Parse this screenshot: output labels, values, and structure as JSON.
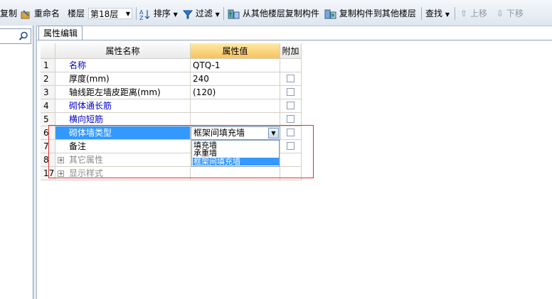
{
  "toolbar": {
    "copy_label": "复制",
    "rename_label": "重命名",
    "floor_label": "楼层",
    "floor_value": "第18层",
    "sort_label": "排序",
    "filter_label": "过滤",
    "copy_from_floor_label": "从其他楼层复制构件",
    "copy_to_floor_label": "复制构件到其他楼层",
    "find_label": "查找",
    "move_up_label": "上移",
    "move_down_label": "下移"
  },
  "panel": {
    "tab_label": "属性编辑"
  },
  "table": {
    "headers": {
      "name": "属性名称",
      "value": "属性值",
      "extra": "附加"
    },
    "rows": [
      {
        "num": "1",
        "name": "名称",
        "value": "QTQ-1",
        "style": "blue",
        "checkbox": false
      },
      {
        "num": "2",
        "name": "厚度(mm)",
        "value": "240",
        "style": "normal",
        "checkbox": true
      },
      {
        "num": "3",
        "name": "轴线距左墙皮距离(mm)",
        "value": "(120)",
        "style": "normal",
        "checkbox": true
      },
      {
        "num": "4",
        "name": "砌体通长筋",
        "value": "",
        "style": "blue",
        "checkbox": true
      },
      {
        "num": "5",
        "name": "横向短筋",
        "value": "",
        "style": "blue",
        "checkbox": true
      },
      {
        "num": "6",
        "name": "砌体墙类型",
        "value": "框架间填充墙",
        "style": "selected",
        "checkbox": true
      },
      {
        "num": "7",
        "name": "备注",
        "value": "",
        "style": "normal",
        "checkbox": true
      },
      {
        "num": "8",
        "name": "其它属性",
        "value": "",
        "style": "group",
        "checkbox": false
      },
      {
        "num": "17",
        "name": "显示样式",
        "value": "",
        "style": "group",
        "checkbox": false
      }
    ]
  },
  "dropdown": {
    "options": [
      "填充墙",
      "承重墙",
      "框架间填充墙"
    ],
    "selected_index": 2
  },
  "colors": {
    "selection": "#3399ff",
    "highlight_box": "#e03030",
    "link_text": "#0000cc"
  }
}
